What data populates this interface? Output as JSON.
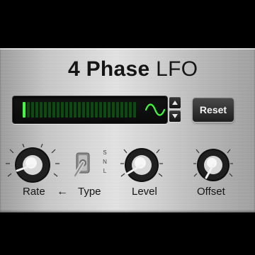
{
  "title": {
    "bold": "4 Phase",
    "light": "LFO"
  },
  "display": {
    "meter_level": 0.04,
    "meter_color": "#3cff3c",
    "meter_dim_color": "#0d4a12",
    "wave_icon": "sine-wave-icon"
  },
  "controls": {
    "reset_label": "Reset",
    "spin_up_icon": "triangle-up-icon",
    "spin_down_icon": "triangle-down-icon"
  },
  "type_switch": {
    "options": [
      "S",
      "N",
      "L"
    ]
  },
  "labels": {
    "rate": "Rate",
    "arrow": "←",
    "type": "Type",
    "level": "Level",
    "offset": "Offset"
  }
}
